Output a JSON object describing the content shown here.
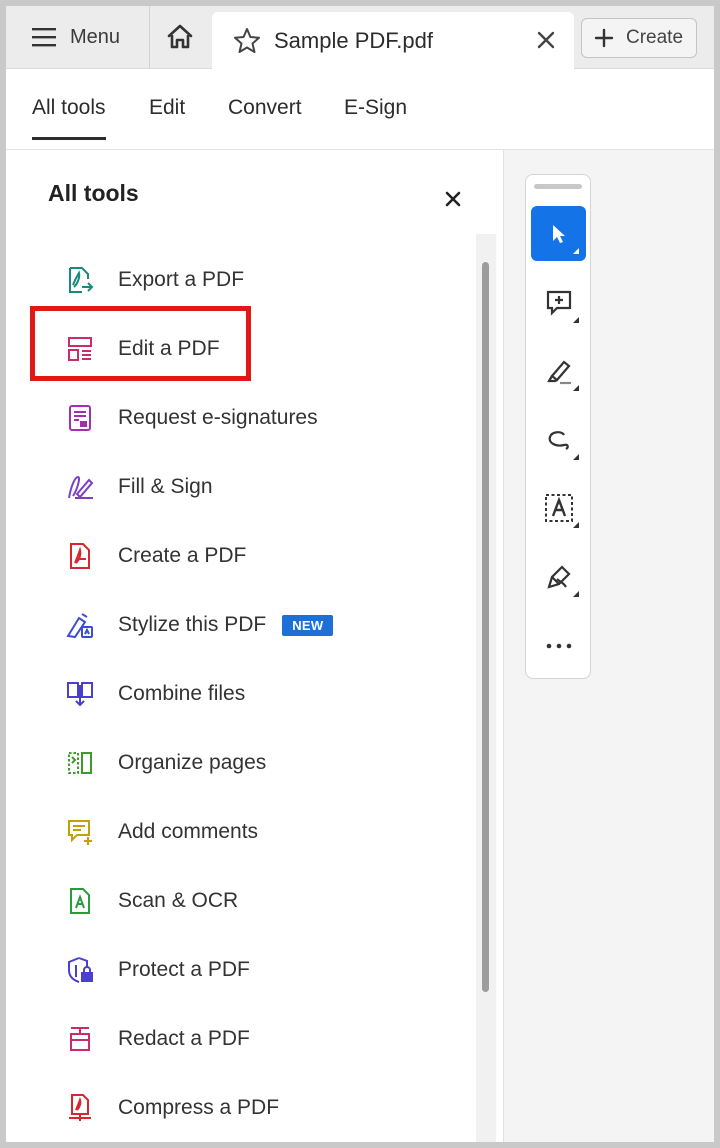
{
  "titlebar": {
    "menu_label": "Menu",
    "tab_title": "Sample PDF.pdf",
    "create_label": "Create"
  },
  "nav_tabs": [
    {
      "label": "All tools",
      "active": true
    },
    {
      "label": "Edit",
      "active": false
    },
    {
      "label": "Convert",
      "active": false
    },
    {
      "label": "E-Sign",
      "active": false
    }
  ],
  "panel": {
    "title": "All tools",
    "highlighted_item": "Edit a PDF",
    "items": [
      {
        "label": "Export a PDF",
        "icon": "export-pdf-icon",
        "color": "#1a8a7c"
      },
      {
        "label": "Edit a PDF",
        "icon": "edit-pdf-icon",
        "color": "#cc2a6a"
      },
      {
        "label": "Request e-signatures",
        "icon": "request-esign-icon",
        "color": "#a12fb0"
      },
      {
        "label": "Fill & Sign",
        "icon": "fill-sign-icon",
        "color": "#7b3fc8"
      },
      {
        "label": "Create a PDF",
        "icon": "create-pdf-icon",
        "color": "#d8262c"
      },
      {
        "label": "Stylize this PDF",
        "icon": "stylize-pdf-icon",
        "color": "#3b4fd0",
        "badge": "NEW"
      },
      {
        "label": "Combine files",
        "icon": "combine-files-icon",
        "color": "#4a3fd0"
      },
      {
        "label": "Organize pages",
        "icon": "organize-pages-icon",
        "color": "#3e9a2a"
      },
      {
        "label": "Add comments",
        "icon": "add-comments-icon",
        "color": "#c6a000"
      },
      {
        "label": "Scan & OCR",
        "icon": "scan-ocr-icon",
        "color": "#2a9a3a"
      },
      {
        "label": "Protect a PDF",
        "icon": "protect-pdf-icon",
        "color": "#4a3fd0"
      },
      {
        "label": "Redact a PDF",
        "icon": "redact-pdf-icon",
        "color": "#cc2a6a"
      },
      {
        "label": "Compress a PDF",
        "icon": "compress-pdf-icon",
        "color": "#d8262c"
      }
    ]
  },
  "quick_toolbar": {
    "items": [
      {
        "icon": "select-cursor-icon",
        "active": true
      },
      {
        "icon": "add-comment-icon",
        "active": false
      },
      {
        "icon": "highlight-pen-icon",
        "active": false
      },
      {
        "icon": "freehand-draw-icon",
        "active": false
      },
      {
        "icon": "text-select-icon",
        "active": false
      },
      {
        "icon": "sign-pen-icon",
        "active": false
      },
      {
        "icon": "more-options-icon",
        "active": false
      }
    ]
  },
  "colors": {
    "accent": "#1473e6",
    "highlight_box": "#e01818",
    "badge_bg": "#1e6fd6"
  }
}
